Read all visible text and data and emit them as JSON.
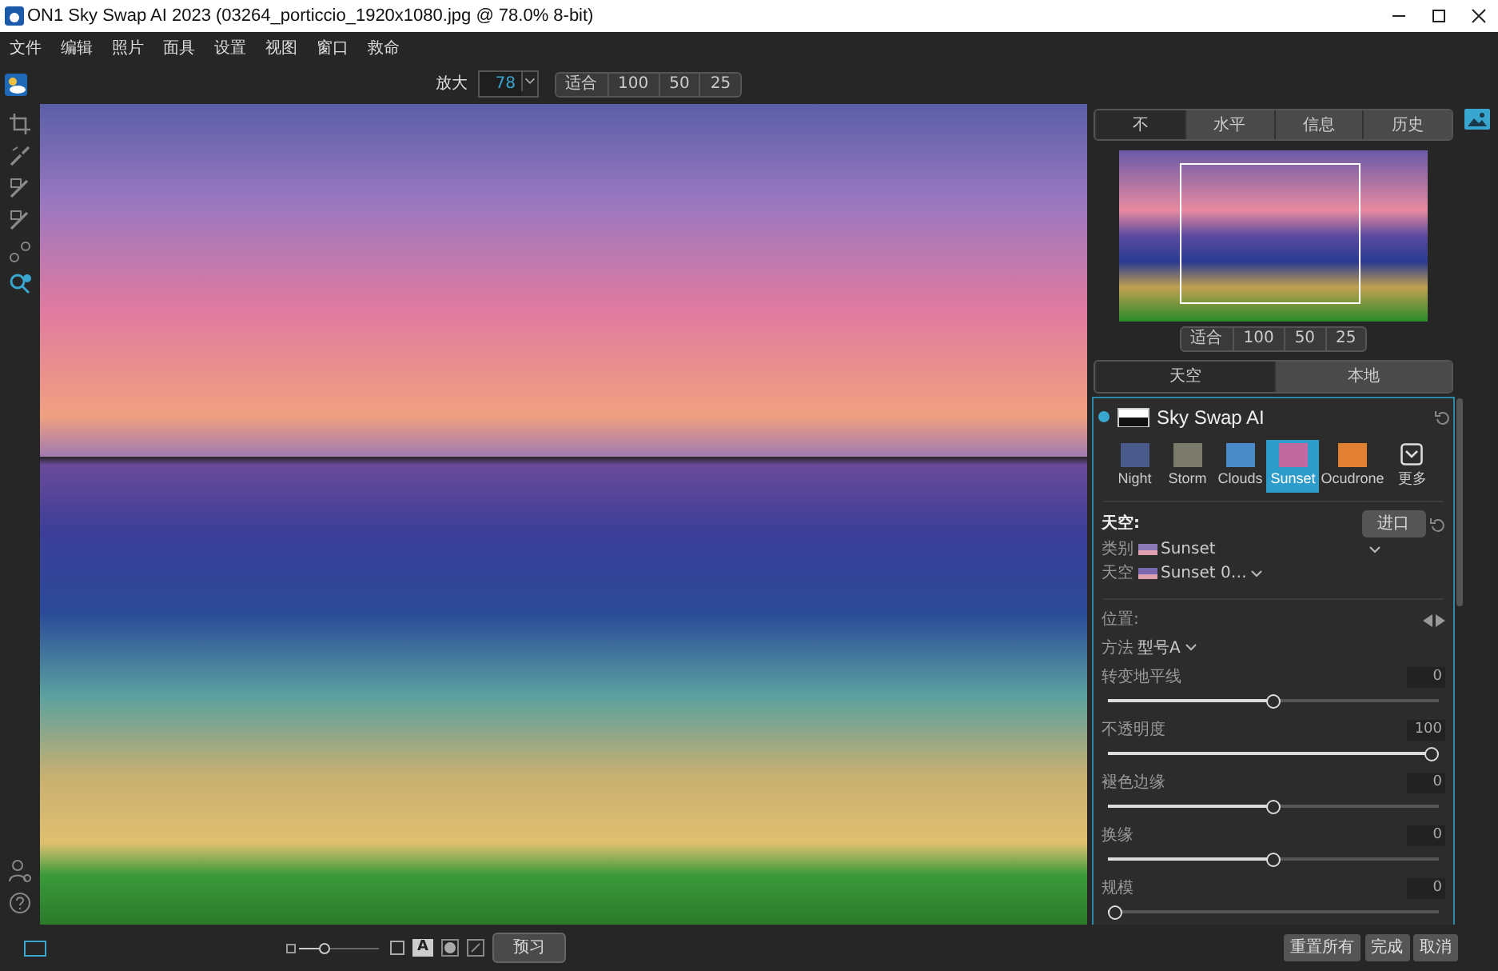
{
  "window": {
    "title": "ON1 Sky Swap AI 2023 (03264_porticcio_1920x1080.jpg @ 78.0% 8-bit)"
  },
  "menu": [
    "文件",
    "编辑",
    "照片",
    "面具",
    "设置",
    "视图",
    "窗口",
    "救命"
  ],
  "toolbar": {
    "zoom_label": "放大",
    "zoom_value": "78",
    "zoom_presets": [
      "适合",
      "100",
      "50",
      "25"
    ]
  },
  "tools": [
    {
      "kind": "crop",
      "selected": false
    },
    {
      "kind": "brush",
      "selected": false
    },
    {
      "kind": "mask-brush",
      "selected": false
    },
    {
      "kind": "mask-brush",
      "selected": false
    },
    {
      "kind": "circles",
      "selected": false
    },
    {
      "kind": "zoom",
      "selected": true
    }
  ],
  "panel_tabs": [
    {
      "label": "不",
      "selected": true
    },
    {
      "label": "水平",
      "selected": false
    },
    {
      "label": "信息",
      "selected": false
    },
    {
      "label": "历史",
      "selected": false
    }
  ],
  "navigator_presets": [
    "适合",
    "100",
    "50",
    "25"
  ],
  "mode_tabs": [
    {
      "label": "天空",
      "selected": true
    },
    {
      "label": "本地",
      "selected": false
    }
  ],
  "filter": {
    "title": "Sky Swap AI",
    "enabled": true,
    "presets": [
      {
        "label": "Night",
        "kind": "thumbnail",
        "color": "#4a5a8a",
        "selected": false
      },
      {
        "label": "Storm",
        "kind": "thumbnail",
        "color": "#7a7a6a",
        "selected": false
      },
      {
        "label": "Clouds",
        "kind": "thumbnail",
        "color": "#4a8ac8",
        "selected": false
      },
      {
        "label": "Sunset",
        "kind": "thumbnail",
        "color": "#c06aa0",
        "selected": true
      },
      {
        "label": "Ocudrone",
        "kind": "thumbnail",
        "color": "#e08030",
        "selected": false
      },
      {
        "label": "更多",
        "kind": "more",
        "selected": false
      }
    ],
    "sky": {
      "heading": "天空:",
      "import_button": "进口",
      "category_label": "类别",
      "category_value": "Sunset",
      "sky_label": "天空",
      "sky_value": "Sunset 0…"
    },
    "position": {
      "heading": "位置:",
      "method_label": "方法",
      "method_value": "型号A"
    },
    "sliders": [
      {
        "label": "转变地平线",
        "reading": "0",
        "level": 0.5
      },
      {
        "label": "不透明度",
        "reading": "100",
        "level": 1
      },
      {
        "label": "褪色边缘",
        "reading": "0",
        "level": 0.5
      },
      {
        "label": "换缘",
        "reading": "0",
        "level": 0.5
      },
      {
        "label": "规模",
        "reading": "0",
        "level": 0
      }
    ]
  },
  "footer_buttons": [
    "重置所有",
    "完成",
    "取消"
  ],
  "bottom_bar": {
    "preview_button": "预习",
    "text_toggle": "A"
  }
}
